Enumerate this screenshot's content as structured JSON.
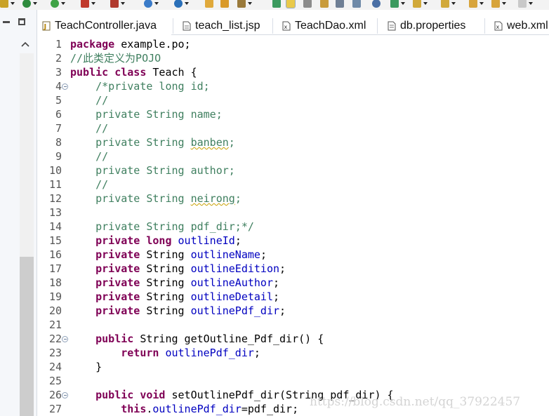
{
  "toolbar": {
    "icons": [
      "debug-icon",
      "run-icon",
      "run-external-icon",
      "stop-icon",
      "new-server-icon",
      "web-browser-icon",
      "open-folder-icon",
      "open-type-icon",
      "search-icon",
      "next-annotation-icon",
      "prev-annotation-icon",
      "history-back-icon",
      "history-forward-icon"
    ]
  },
  "tabs": [
    {
      "label": "TeachController.java",
      "icon": "java-file-icon"
    },
    {
      "label": "teach_list.jsp",
      "icon": "jsp-file-icon"
    },
    {
      "label": "TeachDao.xml",
      "icon": "xml-file-icon"
    },
    {
      "label": "db.properties",
      "icon": "properties-file-icon"
    },
    {
      "label": "web.xml",
      "icon": "xml-file-icon"
    }
  ],
  "editor": {
    "line_numbers": [
      "1",
      "2",
      "3",
      "4",
      "5",
      "6",
      "7",
      "8",
      "9",
      "10",
      "11",
      "12",
      "13",
      "14",
      "15",
      "16",
      "17",
      "18",
      "19",
      "20",
      "21",
      "22",
      "23",
      "24",
      "25",
      "26",
      "27"
    ]
  },
  "watermark": "https://blog.csdn.net/qq_37922457"
}
